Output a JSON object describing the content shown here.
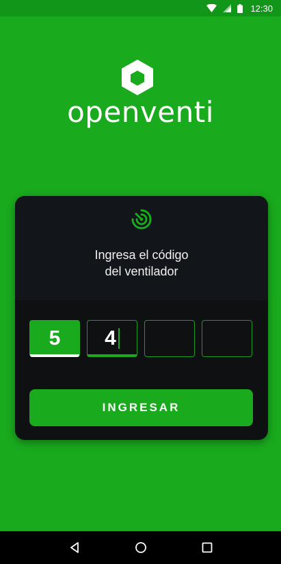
{
  "status_bar": {
    "time": "12:30",
    "icons": [
      "wifi-icon",
      "signal-icon",
      "battery-icon"
    ]
  },
  "app": {
    "logo_text": "openventi"
  },
  "card": {
    "icon": "radar-icon",
    "title_line1": "Ingresa el código",
    "title_line2": "del ventilador",
    "code_digits": [
      "5",
      "4",
      "",
      ""
    ],
    "submit_label": "INGRESAR"
  },
  "navigation": {
    "buttons": [
      "back-icon",
      "home-icon",
      "recents-icon"
    ]
  },
  "colors": {
    "brand_green": "#1aaa1e",
    "status_bar": "#12961a",
    "card_background": "#0f1012",
    "nav_bar": "#000000"
  }
}
